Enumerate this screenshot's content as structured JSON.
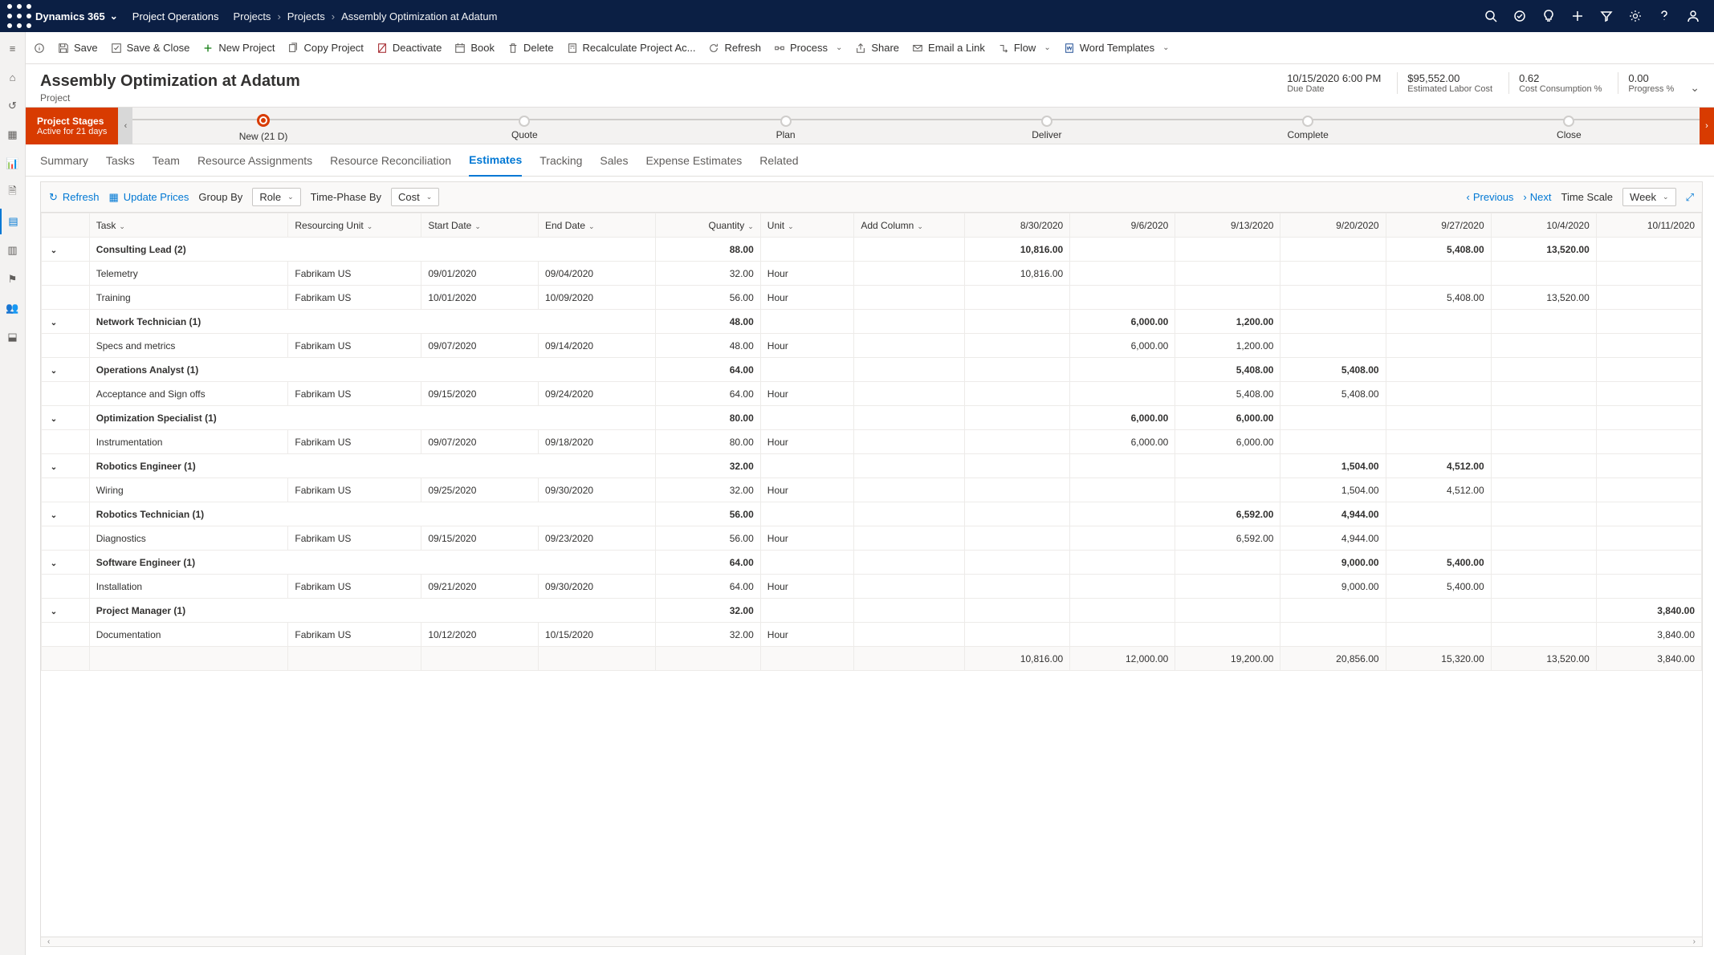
{
  "topnav": {
    "brand": "Dynamics 365",
    "app": "Project Operations",
    "crumbs": [
      "Projects",
      "Projects",
      "Assembly Optimization at Adatum"
    ]
  },
  "commands": {
    "save": "Save",
    "saveClose": "Save & Close",
    "newProject": "New Project",
    "copy": "Copy Project",
    "deactivate": "Deactivate",
    "book": "Book",
    "delete": "Delete",
    "recalc": "Recalculate Project Ac...",
    "refresh": "Refresh",
    "process": "Process",
    "share": "Share",
    "email": "Email a Link",
    "flow": "Flow",
    "word": "Word Templates"
  },
  "header": {
    "title": "Assembly Optimization at Adatum",
    "subtitle": "Project",
    "metrics": [
      {
        "val": "10/15/2020 6:00 PM",
        "lbl": "Due Date"
      },
      {
        "val": "$95,552.00",
        "lbl": "Estimated Labor Cost"
      },
      {
        "val": "0.62",
        "lbl": "Cost Consumption %"
      },
      {
        "val": "0.00",
        "lbl": "Progress %"
      }
    ]
  },
  "stages": {
    "label": "Project Stages",
    "sub": "Active for 21 days",
    "items": [
      {
        "name": "New  (21 D)",
        "current": true
      },
      {
        "name": "Quote"
      },
      {
        "name": "Plan"
      },
      {
        "name": "Deliver"
      },
      {
        "name": "Complete"
      },
      {
        "name": "Close"
      }
    ]
  },
  "tabs": [
    "Summary",
    "Tasks",
    "Team",
    "Resource Assignments",
    "Resource Reconciliation",
    "Estimates",
    "Tracking",
    "Sales",
    "Expense Estimates",
    "Related"
  ],
  "activeTab": "Estimates",
  "toolbar": {
    "refresh": "Refresh",
    "updatePrices": "Update Prices",
    "groupBy": "Group By",
    "groupByVal": "Role",
    "timePhase": "Time-Phase By",
    "timePhaseVal": "Cost",
    "prev": "Previous",
    "next": "Next",
    "timeScale": "Time Scale",
    "timeScaleVal": "Week"
  },
  "columns": {
    "task": "Task",
    "ru": "Resourcing Unit",
    "start": "Start Date",
    "end": "End Date",
    "qty": "Quantity",
    "unit": "Unit",
    "add": "Add Column",
    "periods": [
      "8/30/2020",
      "9/6/2020",
      "9/13/2020",
      "9/20/2020",
      "9/27/2020",
      "10/4/2020",
      "10/11/2020"
    ]
  },
  "groups": [
    {
      "name": "Consulting Lead (2)",
      "qty": "88.00",
      "cells": [
        "10,816.00",
        "",
        "",
        "",
        "5,408.00",
        "13,520.00",
        ""
      ],
      "rows": [
        {
          "task": "Telemetry",
          "ru": "Fabrikam US",
          "start": "09/01/2020",
          "end": "09/04/2020",
          "qty": "32.00",
          "unit": "Hour",
          "cells": [
            "10,816.00",
            "",
            "",
            "",
            "",
            "",
            ""
          ]
        },
        {
          "task": "Training",
          "ru": "Fabrikam US",
          "start": "10/01/2020",
          "end": "10/09/2020",
          "qty": "56.00",
          "unit": "Hour",
          "cells": [
            "",
            "",
            "",
            "",
            "5,408.00",
            "13,520.00",
            ""
          ]
        }
      ]
    },
    {
      "name": "Network Technician (1)",
      "qty": "48.00",
      "cells": [
        "",
        "6,000.00",
        "1,200.00",
        "",
        "",
        "",
        ""
      ],
      "rows": [
        {
          "task": "Specs and metrics",
          "ru": "Fabrikam US",
          "start": "09/07/2020",
          "end": "09/14/2020",
          "qty": "48.00",
          "unit": "Hour",
          "cells": [
            "",
            "6,000.00",
            "1,200.00",
            "",
            "",
            "",
            ""
          ]
        }
      ]
    },
    {
      "name": "Operations Analyst (1)",
      "qty": "64.00",
      "cells": [
        "",
        "",
        "5,408.00",
        "5,408.00",
        "",
        "",
        ""
      ],
      "rows": [
        {
          "task": "Acceptance and Sign offs",
          "ru": "Fabrikam US",
          "start": "09/15/2020",
          "end": "09/24/2020",
          "qty": "64.00",
          "unit": "Hour",
          "cells": [
            "",
            "",
            "5,408.00",
            "5,408.00",
            "",
            "",
            ""
          ]
        }
      ]
    },
    {
      "name": "Optimization Specialist (1)",
      "qty": "80.00",
      "cells": [
        "",
        "6,000.00",
        "6,000.00",
        "",
        "",
        "",
        ""
      ],
      "rows": [
        {
          "task": "Instrumentation",
          "ru": "Fabrikam US",
          "start": "09/07/2020",
          "end": "09/18/2020",
          "qty": "80.00",
          "unit": "Hour",
          "cells": [
            "",
            "6,000.00",
            "6,000.00",
            "",
            "",
            "",
            ""
          ]
        }
      ]
    },
    {
      "name": "Robotics Engineer (1)",
      "qty": "32.00",
      "cells": [
        "",
        "",
        "",
        "1,504.00",
        "4,512.00",
        "",
        ""
      ],
      "rows": [
        {
          "task": "Wiring",
          "ru": "Fabrikam US",
          "start": "09/25/2020",
          "end": "09/30/2020",
          "qty": "32.00",
          "unit": "Hour",
          "cells": [
            "",
            "",
            "",
            "1,504.00",
            "4,512.00",
            "",
            ""
          ]
        }
      ]
    },
    {
      "name": "Robotics Technician (1)",
      "qty": "56.00",
      "cells": [
        "",
        "",
        "6,592.00",
        "4,944.00",
        "",
        "",
        ""
      ],
      "rows": [
        {
          "task": "Diagnostics",
          "ru": "Fabrikam US",
          "start": "09/15/2020",
          "end": "09/23/2020",
          "qty": "56.00",
          "unit": "Hour",
          "cells": [
            "",
            "",
            "6,592.00",
            "4,944.00",
            "",
            "",
            ""
          ]
        }
      ]
    },
    {
      "name": "Software Engineer (1)",
      "qty": "64.00",
      "cells": [
        "",
        "",
        "",
        "9,000.00",
        "5,400.00",
        "",
        ""
      ],
      "rows": [
        {
          "task": "Installation",
          "ru": "Fabrikam US",
          "start": "09/21/2020",
          "end": "09/30/2020",
          "qty": "64.00",
          "unit": "Hour",
          "cells": [
            "",
            "",
            "",
            "9,000.00",
            "5,400.00",
            "",
            ""
          ]
        }
      ]
    },
    {
      "name": "Project Manager (1)",
      "qty": "32.00",
      "cells": [
        "",
        "",
        "",
        "",
        "",
        "",
        "3,840.00"
      ],
      "rows": [
        {
          "task": "Documentation",
          "ru": "Fabrikam US",
          "start": "10/12/2020",
          "end": "10/15/2020",
          "qty": "32.00",
          "unit": "Hour",
          "cells": [
            "",
            "",
            "",
            "",
            "",
            "",
            "3,840.00"
          ]
        }
      ]
    }
  ],
  "totals": [
    "10,816.00",
    "12,000.00",
    "19,200.00",
    "20,856.00",
    "15,320.00",
    "13,520.00",
    "3,840.00"
  ]
}
